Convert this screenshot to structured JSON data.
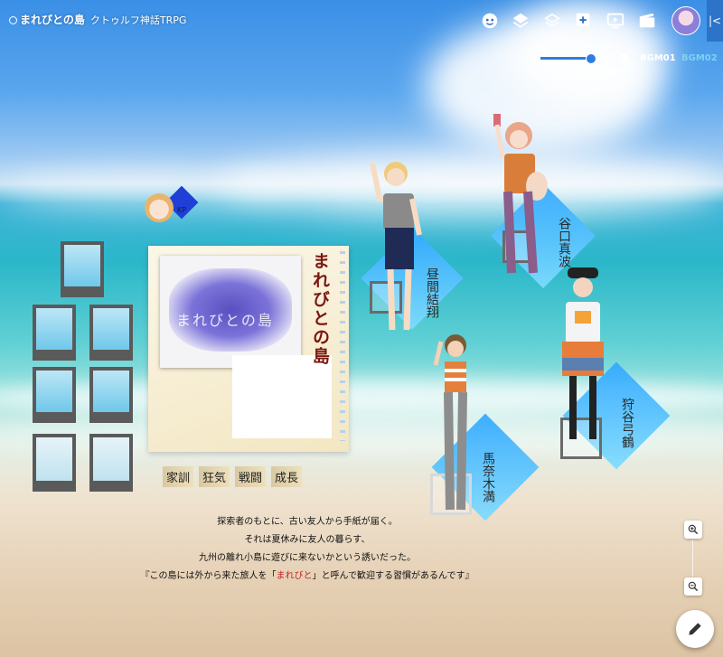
{
  "header": {
    "title": "まれびとの島",
    "subtitle": "クトゥルフ神話TRPG",
    "icons": [
      "face-icon",
      "layers-icon",
      "layers-outline-icon",
      "add-box-icon",
      "play-screen-icon",
      "movie-icon"
    ],
    "collapse_label": "|<"
  },
  "bgm": {
    "tabs": [
      "BGM01",
      "BGM02"
    ],
    "active": "BGM01",
    "volume": 0.9
  },
  "colors": {
    "accent": "#2f7de1",
    "diamond": "#2fa7ff",
    "kp_diamond": "#1f3fd6",
    "title_red": "#7a1812"
  },
  "kp": {
    "label": "KP"
  },
  "notebook": {
    "vertical_title": "まれびとの島",
    "cover_title": "まれびとの島"
  },
  "tags": [
    "家訓",
    "狂気",
    "戦闘",
    "成長"
  ],
  "story": {
    "line1": "探索者のもとに、古い友人から手紙が届く。",
    "line2": "それは夏休みに友人の暮らす、",
    "line3": "九州の離れ小島に遊びに来ないかという誘いだった。",
    "line4_a": "『この島には外から来た旅人を「",
    "line4_b": "まれびと",
    "line4_c": "」と呼んで歓迎する習慣があるんです』"
  },
  "characters": [
    {
      "name": "昼間結翔",
      "caption": ""
    },
    {
      "name": "谷口真波",
      "caption": ""
    },
    {
      "name": "馬奈木満",
      "caption": ""
    },
    {
      "name": "狩谷弓鶴",
      "caption": ""
    }
  ]
}
